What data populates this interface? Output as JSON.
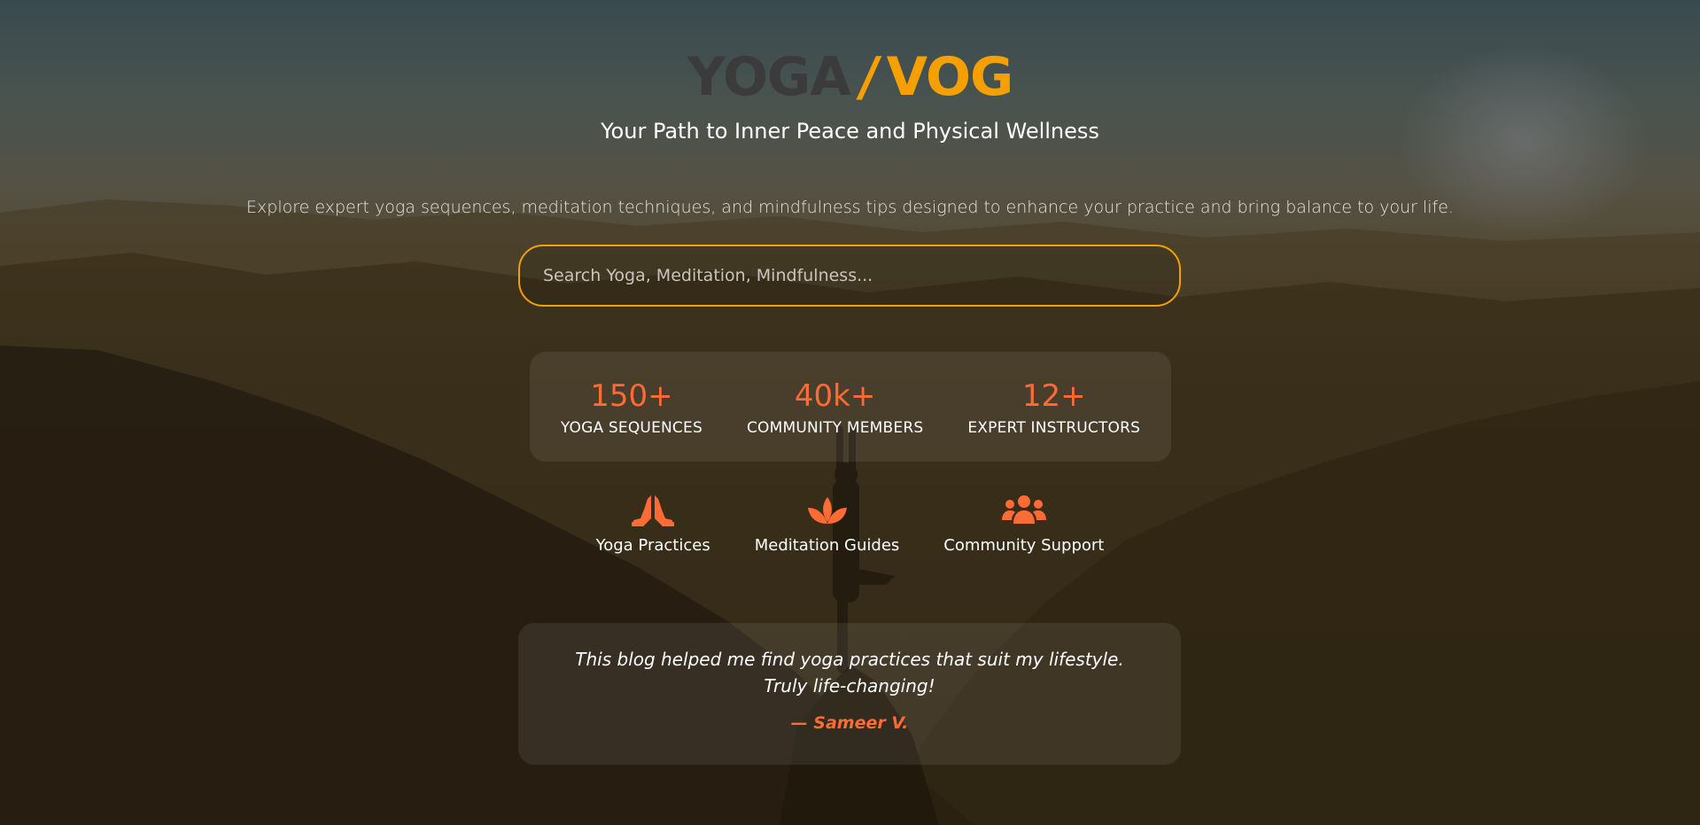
{
  "brand": {
    "logo_left": "YOGA",
    "logo_slash": "/",
    "logo_right": "VOG",
    "accent_color": "#f5a000",
    "highlight_color": "#ff6b35"
  },
  "hero": {
    "subtitle": "Your Path to Inner Peace and Physical Wellness",
    "description": "Explore expert yoga sequences, meditation techniques, and mindfulness tips designed to enhance your practice and bring balance to your life."
  },
  "search": {
    "placeholder": "Search Yoga, Meditation, Mindfulness...",
    "value": ""
  },
  "stats": [
    {
      "number": "150+",
      "label": "YOGA SEQUENCES"
    },
    {
      "number": "40k+",
      "label": "COMMUNITY MEMBERS"
    },
    {
      "number": "12+",
      "label": "EXPERT INSTRUCTORS"
    }
  ],
  "features": [
    {
      "icon": "praying-hands-icon",
      "label": "Yoga Practices"
    },
    {
      "icon": "lotus-icon",
      "label": "Meditation Guides"
    },
    {
      "icon": "users-icon",
      "label": "Community Support"
    }
  ],
  "testimonial": {
    "quote": "This blog helped me find yoga practices that suit my lifestyle. Truly life-changing!",
    "author": "— Sameer V."
  }
}
